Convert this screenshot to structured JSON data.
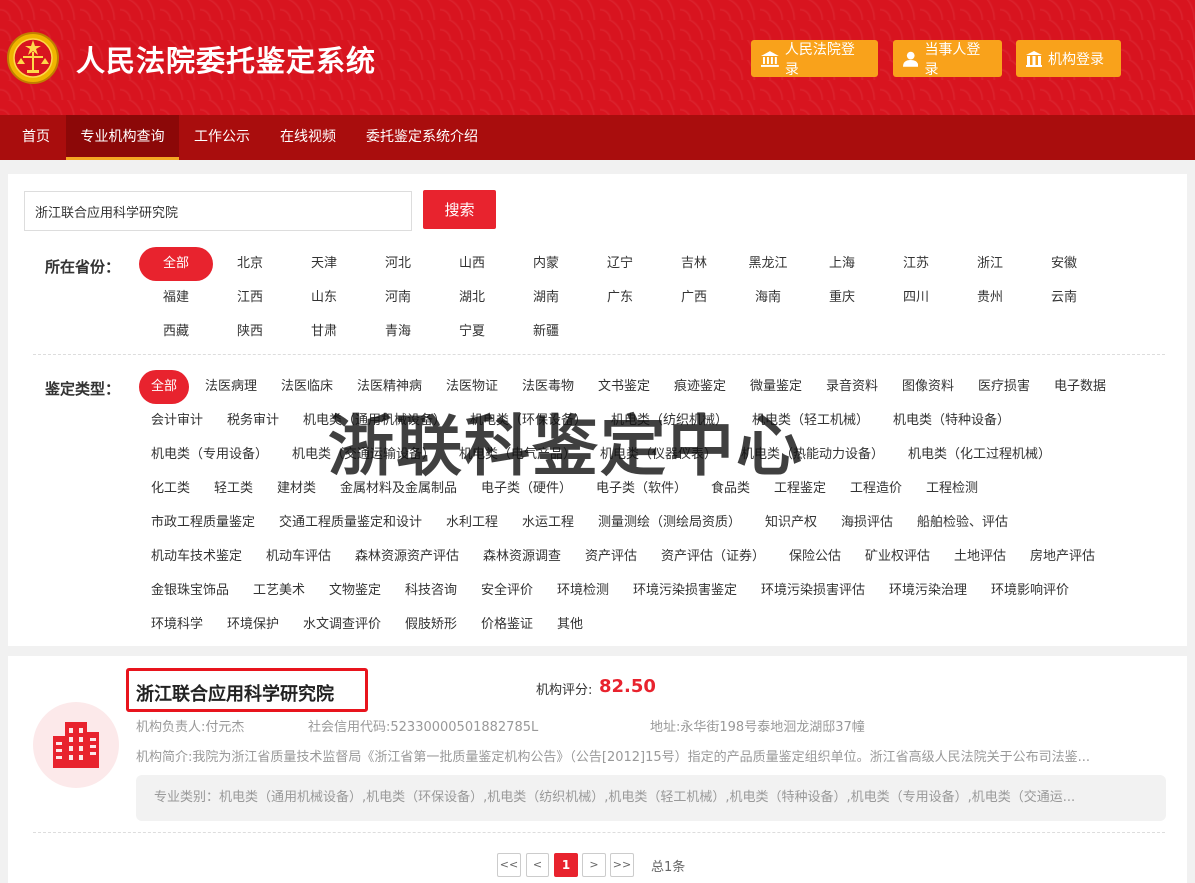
{
  "header": {
    "title": "人民法院委托鉴定系统",
    "logins": [
      {
        "label": "人民法院登录",
        "icon": "bank-icon"
      },
      {
        "label": "当事人登录",
        "icon": "person-icon"
      },
      {
        "label": "机构登录",
        "icon": "building-icon"
      }
    ]
  },
  "nav": {
    "items": [
      "首页",
      "专业机构查询",
      "工作公示",
      "在线视频",
      "委托鉴定系统介绍"
    ],
    "active": "专业机构查询"
  },
  "search": {
    "value": "浙江联合应用科学研究院",
    "button": "搜索"
  },
  "province": {
    "label": "所在省份：",
    "items": [
      "全部",
      "北京",
      "天津",
      "河北",
      "山西",
      "内蒙",
      "辽宁",
      "吉林",
      "黑龙江",
      "上海",
      "江苏",
      "浙江",
      "安徽",
      "福建",
      "江西",
      "山东",
      "河南",
      "湖北",
      "湖南",
      "广东",
      "广西",
      "海南",
      "重庆",
      "四川",
      "贵州",
      "云南",
      "西藏",
      "陕西",
      "甘肃",
      "青海",
      "宁夏",
      "新疆"
    ],
    "selected": "全部"
  },
  "type_filter": {
    "label": "鉴定类型：",
    "rows": [
      [
        "全部",
        "法医病理",
        "法医临床",
        "法医精神病",
        "法医物证",
        "法医毒物",
        "文书鉴定",
        "痕迹鉴定",
        "微量鉴定",
        "录音资料",
        "图像资料",
        "医疗损害",
        "电子数据"
      ],
      [
        "会计审计",
        "税务审计",
        "机电类（通用机械设备）",
        "机电类（环保设备）",
        "机电类（纺织机械）",
        "机电类（轻工机械）",
        "机电类（特种设备）"
      ],
      [
        "机电类（专用设备）",
        "机电类（交通运输设备）",
        "机电类（电气产品）",
        "机电类（仪器仪表）",
        "机电类（热能动力设备）",
        "机电类（化工过程机械）"
      ],
      [
        "化工类",
        "轻工类",
        "建材类",
        "金属材料及金属制品",
        "电子类（硬件）",
        "电子类（软件）",
        "食品类",
        "工程鉴定",
        "工程造价",
        "工程检测"
      ],
      [
        "市政工程质量鉴定",
        "交通工程质量鉴定和设计",
        "水利工程",
        "水运工程",
        "测量测绘（测绘局资质）",
        "知识产权",
        "海损评估",
        "船舶检验、评估"
      ],
      [
        "机动车技术鉴定",
        "机动车评估",
        "森林资源资产评估",
        "森林资源调查",
        "资产评估",
        "资产评估（证券）",
        "保险公估",
        "矿业权评估",
        "土地评估",
        "房地产评估"
      ],
      [
        "金银珠宝饰品",
        "工艺美术",
        "文物鉴定",
        "科技咨询",
        "安全评价",
        "环境检测",
        "环境污染损害鉴定",
        "环境污染损害评估",
        "环境污染治理",
        "环境影响评价"
      ],
      [
        "环境科学",
        "环境保护",
        "水文调查评价",
        "假肢矫形",
        "价格鉴证",
        "其他"
      ]
    ],
    "selected": "全部"
  },
  "watermark": "浙联科鉴定中心",
  "result": {
    "name": "浙江联合应用科学研究院",
    "score_label": "机构评分:",
    "score": "82.50",
    "leader": "机构负责人:付元杰",
    "credit_code": "社会信用代码:52330000501882785L",
    "address": "地址:永华街198号泰地洄龙湖邸37幢",
    "intro": "机构简介:我院为浙江省质量技术监督局《浙江省第一批质量鉴定机构公告》（公告[2012]15号）指定的产品质量鉴定组织单位。浙江省高级人民法院关于公布司法鉴...",
    "categories": "专业类别：机电类（通用机械设备）,机电类（环保设备）,机电类（纺织机械）,机电类（轻工机械）,机电类（特种设备）,机电类（专用设备）,机电类（交通运..."
  },
  "pagination": {
    "first": "<<",
    "prev": "<",
    "current": "1",
    "next": ">",
    "last": ">>",
    "total": "总1条"
  },
  "colors": {
    "brand_red": "#d8141f",
    "nav_red": "#a90d0d",
    "accent_orange": "#f9a21b",
    "active_red": "#e8232e"
  }
}
